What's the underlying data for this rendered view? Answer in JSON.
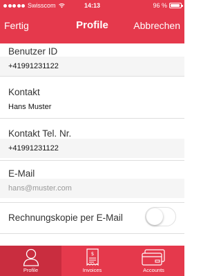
{
  "status_bar": {
    "carrier": "Swisscom",
    "time": "14:13",
    "battery": "96 %",
    "battery_level": 0.96
  },
  "nav": {
    "left": "Fertig",
    "title": "Profile",
    "right": "Abbrechen"
  },
  "fields": [
    {
      "label": "Benutzer ID",
      "value": "+41991231122"
    },
    {
      "label": "Kontakt",
      "value": "Hans Muster"
    },
    {
      "label": "Kontakt Tel. Nr.",
      "value": "+41991231122"
    },
    {
      "label": "E-Mail",
      "placeholder": "hans@muster.com"
    }
  ],
  "toggle": {
    "label": "Rechnungskopie per E-Mail",
    "on": false
  },
  "tabs": [
    {
      "label": "Profile",
      "icon": "person-icon",
      "active": true
    },
    {
      "label": "Invoices",
      "icon": "invoice-icon",
      "active": false
    },
    {
      "label": "Accounts",
      "icon": "credit-cards-icon",
      "active": false
    }
  ],
  "colors": {
    "brand": "#e5394c",
    "active_tab": "#c92d3f"
  }
}
